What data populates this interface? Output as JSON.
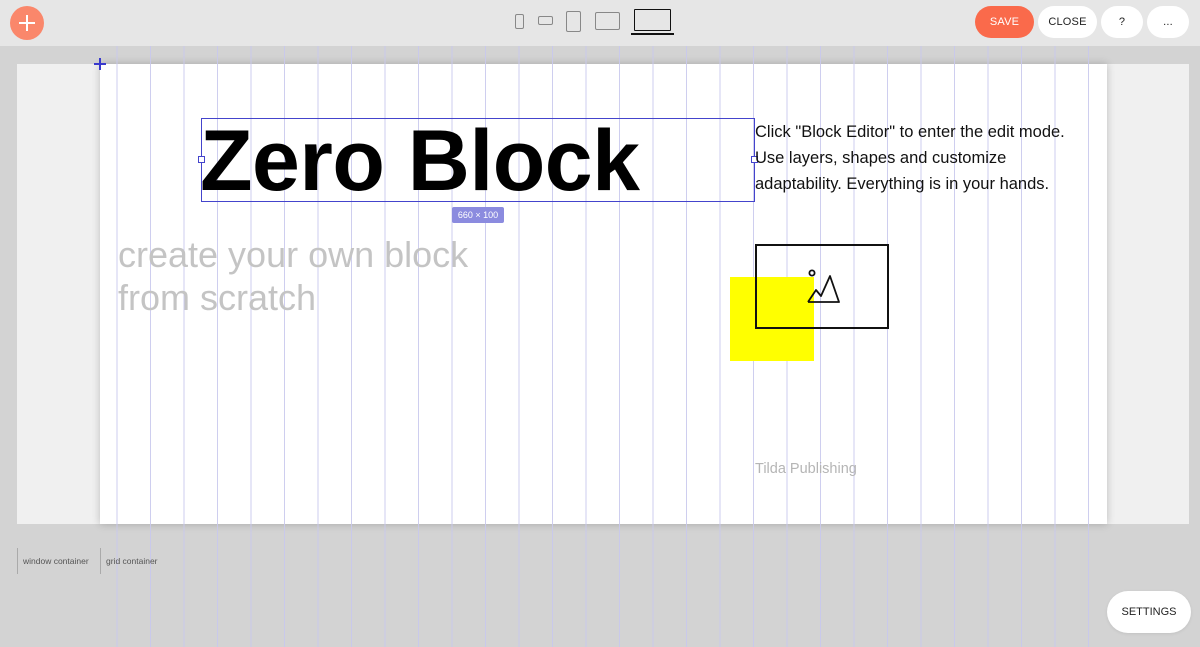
{
  "toolbar": {
    "save_label": "SAVE",
    "close_label": "CLOSE",
    "help_label": "?",
    "more_label": "...",
    "accent_color": "#fa6a4b",
    "add_color": "#fa876b"
  },
  "devices": {
    "icons": [
      "phone-portrait-icon",
      "phone-landscape-icon",
      "tablet-portrait-icon",
      "tablet-landscape-icon",
      "laptop-icon"
    ],
    "selected": "laptop-icon"
  },
  "canvas": {
    "title": "Zero Block",
    "size_badge": "660 × 100",
    "subtitle": "create your own block from scratch",
    "description": "Click \"Block Editor\" to enter the edit mode. Use layers, shapes and customize adaptability. Everything is in your hands.",
    "brand": "Tilda Publishing",
    "shape_color": "#ffff00",
    "image_icon": "image-placeholder-icon"
  },
  "containers": {
    "window_label": "window container",
    "grid_label": "grid container"
  },
  "footer": {
    "settings_label": "SETTINGS"
  }
}
